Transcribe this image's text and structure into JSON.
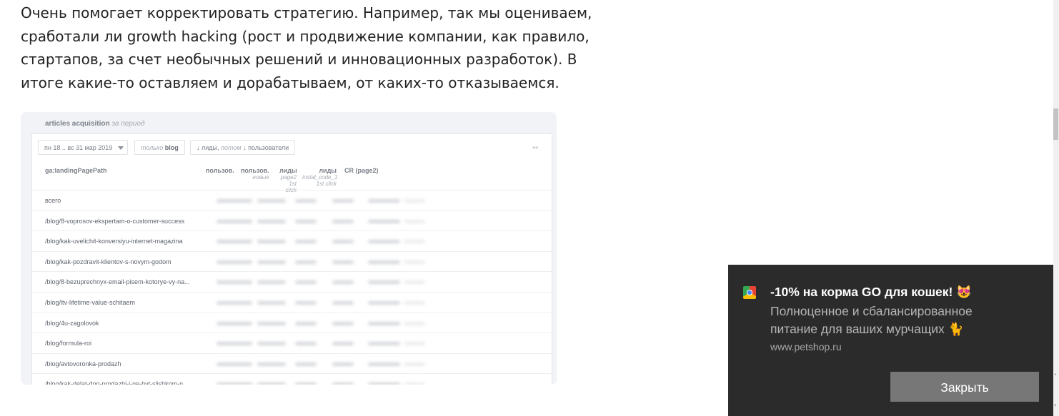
{
  "article": {
    "lines": [
      "Очень помогает корректировать стратегию. Например, так мы оцениваем,",
      "сработали ли growth hacking (рост и продвижение компании, как правило,",
      "стартапов, за счет необычных решений и инновационных разработок). В",
      "итоге какие-то оставляем и дорабатываем, от каких-то отказываемся."
    ]
  },
  "report": {
    "title": "articles acquisition",
    "title_suffix": "за период",
    "date_range": "пн 18 .. вс 31 мар 2019",
    "filter_prefix": "только",
    "filter_value": "blog",
    "sort_label": "↓ лиды,",
    "sort_then": "потом",
    "sort_second": "↓ пользователи",
    "expand_icon": "↔",
    "columns": [
      {
        "label": "ga:landingPagePath",
        "sub": ""
      },
      {
        "label": "пользов.",
        "sub": ""
      },
      {
        "label": "пользов.",
        "sub": "новые"
      },
      {
        "label": "лиды",
        "sub": "page2 1st click"
      },
      {
        "label": "лиды",
        "sub": "instal_code_1 1st click"
      },
      {
        "label": "CR (page2)",
        "sub": ""
      }
    ],
    "rows": [
      "всего",
      "/blog/8-voprosov-ekspertam-o-customer-success",
      "/blog/kak-uvelichit-konversiyu-internet-magazina",
      "/blog/kak-pozdravit-klientov-s-novym-godom",
      "/blog/8-bezuprechnyx-email-pisem-kotorye-vy-na...",
      "/blog/ltv-lifetime-value-schitaem",
      "/blog/4u-zagolovok",
      "/blog/formula-roi",
      "/blog/avtovoronka-prodazh",
      "/blog/kak-delat-dop-prodazhi-i-ne-byt-slishkom-n..."
    ]
  },
  "notification": {
    "app_icon": "chrome-icon",
    "title": "-10% на корма GO для кошек! 😻",
    "body": "Полноценное и сбалансированное питание для ваших мурчащих 🐈",
    "url": "www.petshop.ru",
    "close_label": "Закрыть"
  },
  "colors": {
    "toast_bg": "#2b2b2b",
    "toast_button": "#777777"
  }
}
